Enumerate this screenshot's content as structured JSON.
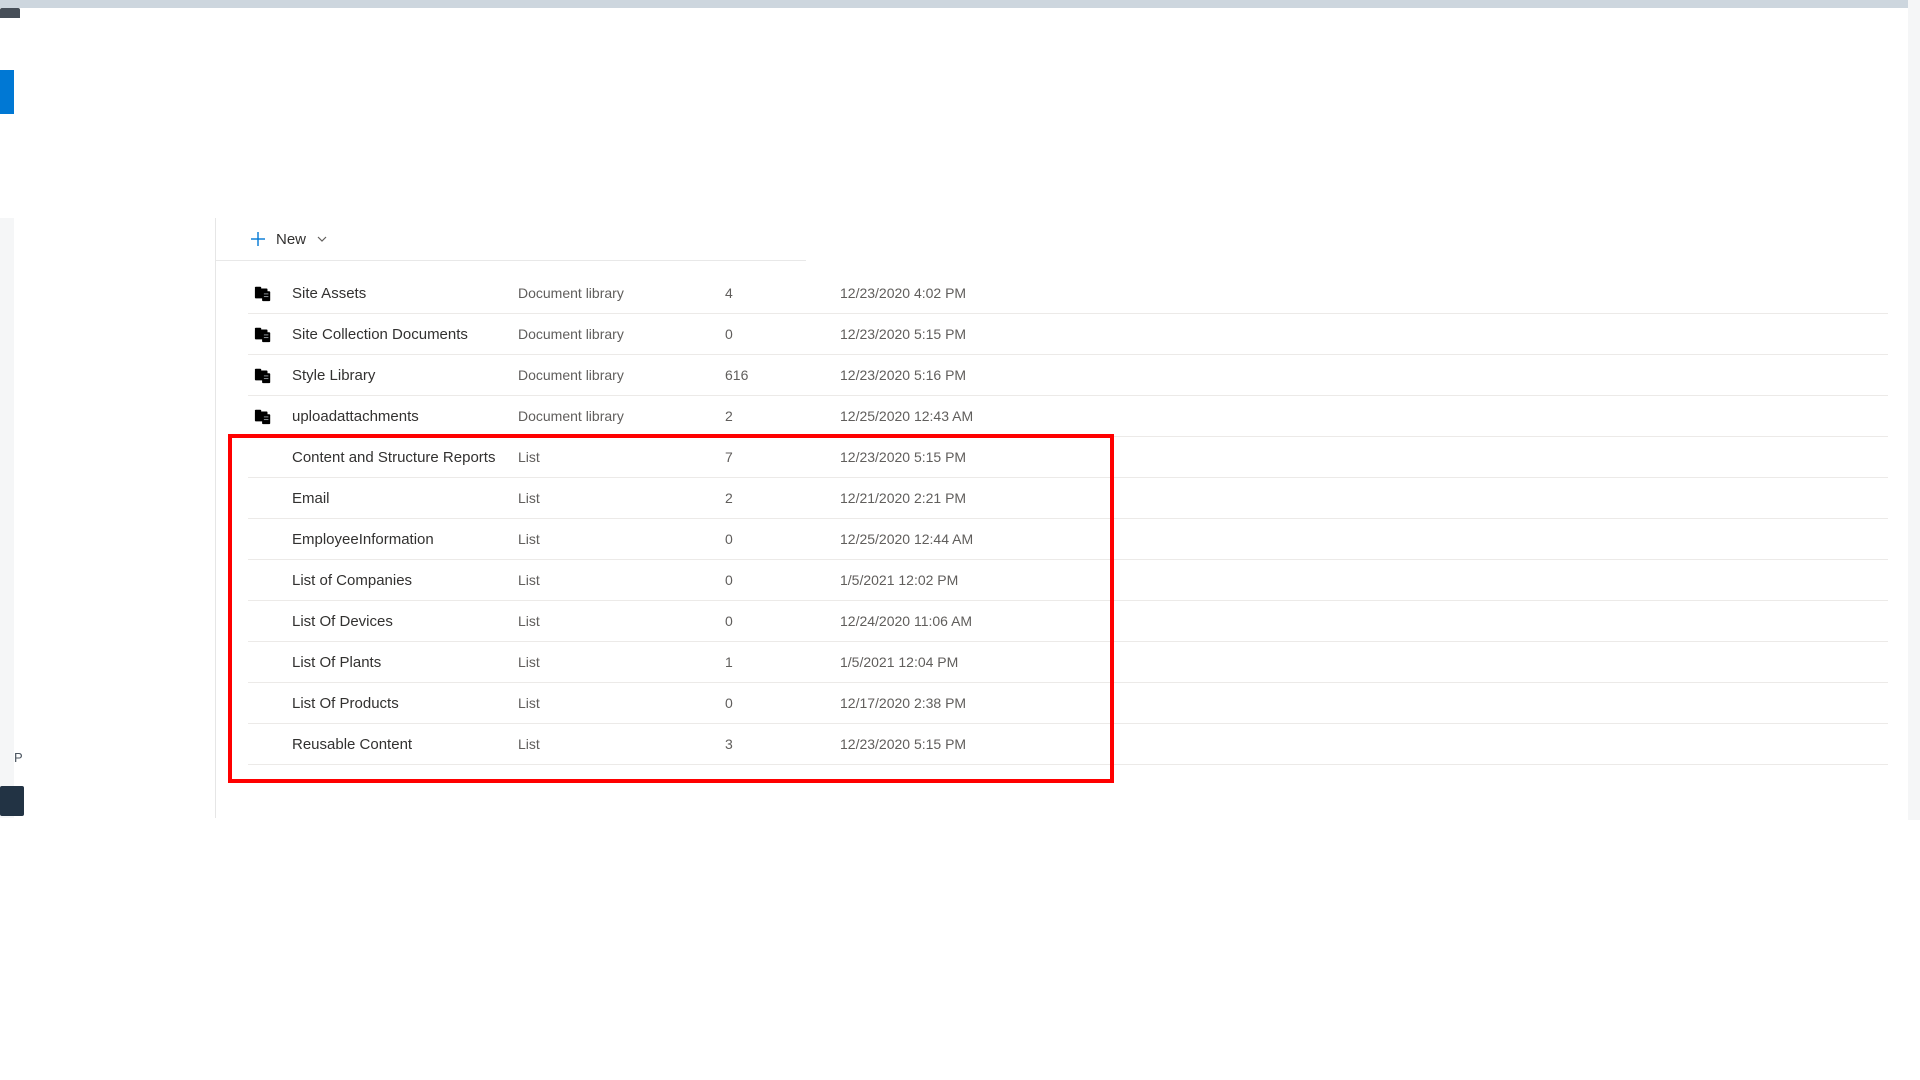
{
  "toolbar": {
    "new_label": "New"
  },
  "type_labels": {
    "doclib": "Document library",
    "list": "List"
  },
  "left_fragment_label": "P",
  "rows": [
    {
      "icon": "doclib",
      "name": "Site Assets",
      "type": "Document library",
      "count": "4",
      "date": "12/23/2020 4:02 PM",
      "highlighted": false
    },
    {
      "icon": "doclib",
      "name": "Site Collection Documents",
      "type": "Document library",
      "count": "0",
      "date": "12/23/2020 5:15 PM",
      "highlighted": false
    },
    {
      "icon": "doclib",
      "name": "Style Library",
      "type": "Document library",
      "count": "616",
      "date": "12/23/2020 5:16 PM",
      "highlighted": false
    },
    {
      "icon": "doclib",
      "name": "uploadattachments",
      "type": "Document library",
      "count": "2",
      "date": "12/25/2020 12:43 AM",
      "highlighted": false
    },
    {
      "icon": "list",
      "name": "Content and Structure Reports",
      "type": "List",
      "count": "7",
      "date": "12/23/2020 5:15 PM",
      "highlighted": true
    },
    {
      "icon": "list",
      "name": "Email",
      "type": "List",
      "count": "2",
      "date": "12/21/2020 2:21 PM",
      "highlighted": true
    },
    {
      "icon": "list",
      "name": "EmployeeInformation",
      "type": "List",
      "count": "0",
      "date": "12/25/2020 12:44 AM",
      "highlighted": true
    },
    {
      "icon": "list",
      "name": "List of Companies",
      "type": "List",
      "count": "0",
      "date": "1/5/2021 12:02 PM",
      "highlighted": true
    },
    {
      "icon": "list",
      "name": "List Of Devices",
      "type": "List",
      "count": "0",
      "date": "12/24/2020 11:06 AM",
      "highlighted": true
    },
    {
      "icon": "list",
      "name": "List Of Plants",
      "type": "List",
      "count": "1",
      "date": "1/5/2021 12:04 PM",
      "highlighted": true
    },
    {
      "icon": "list",
      "name": "List Of Products",
      "type": "List",
      "count": "0",
      "date": "12/17/2020 2:38 PM",
      "highlighted": true
    },
    {
      "icon": "list",
      "name": "Reusable Content",
      "type": "List",
      "count": "3",
      "date": "12/23/2020 5:15 PM",
      "highlighted": true
    }
  ]
}
